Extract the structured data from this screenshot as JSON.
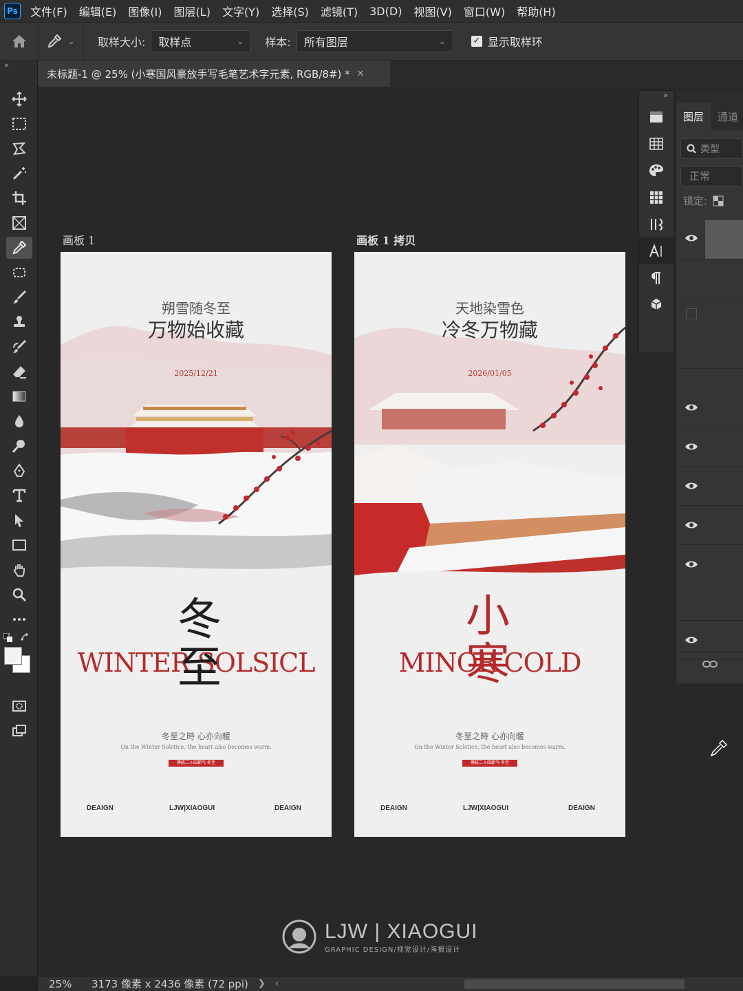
{
  "app": {
    "logo": "Ps"
  },
  "menu": [
    "文件(F)",
    "编辑(E)",
    "图像(I)",
    "图层(L)",
    "文字(Y)",
    "选择(S)",
    "滤镜(T)",
    "3D(D)",
    "视图(V)",
    "窗口(W)",
    "帮助(H)"
  ],
  "options": {
    "sample_size_label": "取样大小:",
    "sample_size_value": "取样点",
    "sample_label": "样本:",
    "sample_value": "所有图层",
    "show_ring_label": "显示取样环",
    "show_ring_checked": true
  },
  "document_tab": {
    "title": "未标题-1 @ 25% (小寒国风豪放手写毛笔艺术字元素, RGB/8#) *"
  },
  "artboards": [
    {
      "label": "画板 1",
      "line1": "朔雪随冬至",
      "line2": "万物始收藏",
      "date": "2025/12/21",
      "headline": "WINTER SOLSICL",
      "calligraphy": "冬至",
      "subtitle_cn": "冬至之時 心亦向暖",
      "subtitle_en": "On the Winter Solstice, the heart also becomes warm.",
      "tag": "傳統二十四節气·冬至",
      "footer": [
        "DEAIGN",
        "LJW|XIAOGUI",
        "DEAIGN"
      ]
    },
    {
      "label": "画板 1 拷贝",
      "line1": "天地染雪色",
      "line2": "冷冬万物藏",
      "date": "2026/01/05",
      "headline": "MINOR COLD",
      "calligraphy": "小寒",
      "subtitle_cn": "冬至之時 心亦向暖",
      "subtitle_en": "On the Winter Solstice, the heart also becomes warm.",
      "tag": "傳統二十四節气·冬至",
      "footer": [
        "DEAIGN",
        "LJW|XIAOGUI",
        "DEAIGN"
      ]
    }
  ],
  "watermark": {
    "title": "LJW | XIAOGUI",
    "subtitle": "GRAPHIC DESIGN/视觉设计/海报设计"
  },
  "layers_panel": {
    "tabs": [
      "图层",
      "通道"
    ],
    "search_placeholder": "类型",
    "blend_mode": "正常",
    "lock_label": "锁定:"
  },
  "status": {
    "zoom": "25%",
    "doc_info": "3173 像素 x 2436 像素 (72 ppi)"
  },
  "colors": {
    "accent_red": "#b42a2a",
    "ui_dark": "#282828",
    "panel": "#353535"
  },
  "tools": [
    "move-icon",
    "marquee-icon",
    "lasso-icon",
    "magic-wand-icon",
    "crop-icon",
    "frame-icon",
    "eyedropper-icon",
    "patch-icon",
    "brush-icon",
    "stamp-icon",
    "history-brush-icon",
    "eraser-icon",
    "gradient-icon",
    "blur-icon",
    "dodge-icon",
    "pen-icon",
    "type-icon",
    "path-select-icon",
    "rectangle-icon",
    "hand-icon",
    "zoom-icon",
    "more-icon"
  ]
}
